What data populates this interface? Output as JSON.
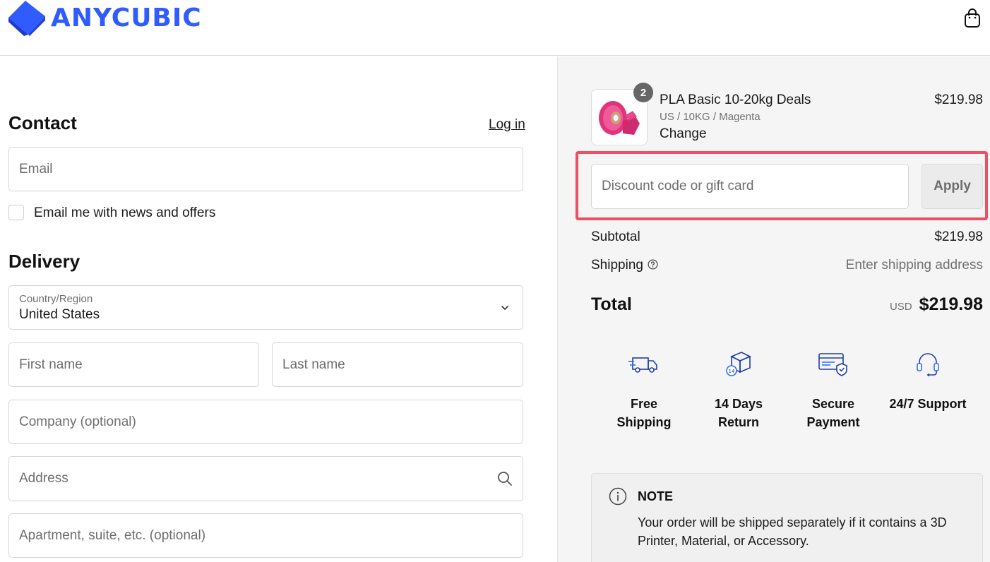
{
  "brand": {
    "name": "ANYCUBIC",
    "color": "#2f5bff"
  },
  "header": {
    "cart_icon": "shopping-bag-icon"
  },
  "contact": {
    "title": "Contact",
    "login_label": "Log in",
    "email_placeholder": "Email",
    "newsletter_label": "Email me with news and offers",
    "newsletter_checked": false
  },
  "delivery": {
    "title": "Delivery",
    "country_label": "Country/Region",
    "country_value": "United States",
    "first_name_placeholder": "First name",
    "last_name_placeholder": "Last name",
    "company_placeholder": "Company (optional)",
    "address_placeholder": "Address",
    "apartment_placeholder": "Apartment, suite, etc. (optional)"
  },
  "order": {
    "item": {
      "quantity": "2",
      "title": "PLA Basic 10-20kg Deals",
      "variant": "US / 10KG / Magenta",
      "change_label": "Change",
      "price": "$219.98"
    },
    "discount": {
      "placeholder": "Discount code or gift card",
      "apply_label": "Apply",
      "highlight_color": "#ef4f63"
    },
    "subtotal_label": "Subtotal",
    "subtotal_value": "$219.98",
    "shipping_label": "Shipping",
    "shipping_value": "Enter shipping address",
    "total_label": "Total",
    "total_currency": "USD",
    "total_value": "$219.98"
  },
  "features": [
    {
      "icon": "delivery-truck-icon",
      "label": "Free\nShipping"
    },
    {
      "icon": "return-box-icon",
      "label": "14 Days\nReturn"
    },
    {
      "icon": "secure-card-icon",
      "label": "Secure\nPayment"
    },
    {
      "icon": "headset-icon",
      "label": "24/7 Support"
    }
  ],
  "note": {
    "title": "NOTE",
    "text": "Your order will be shipped separately if it contains a 3D Printer, Material, or Accessory."
  }
}
